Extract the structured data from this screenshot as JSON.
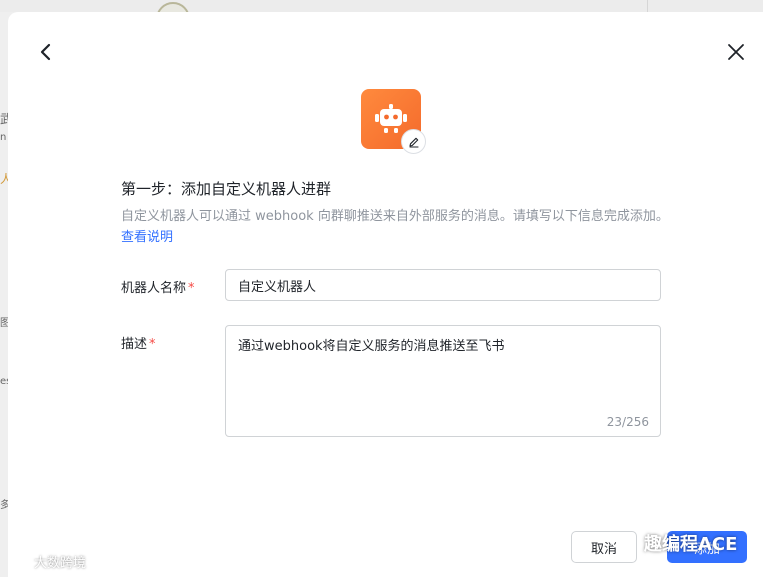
{
  "background": {
    "fragments": [
      "武",
      "n",
      "人",
      "图",
      "es",
      "多"
    ]
  },
  "dialog": {
    "step_title": "第一步：添加自定义机器人进群",
    "description": "自定义机器人可以通过 webhook 向群聊推送来自外部服务的消息。请填写以下信息完成添加。",
    "help_link": "查看说明",
    "name_field": {
      "label": "机器人名称",
      "required_mark": "*",
      "value": "自定义机器人"
    },
    "desc_field": {
      "label": "描述",
      "required_mark": "*",
      "value": "通过webhook将自定义服务的消息推送至飞书",
      "counter": "23/256"
    },
    "buttons": {
      "cancel": "取消",
      "add": "添加"
    }
  },
  "watermarks": {
    "right": "趣编程ACE",
    "left": "大数跨境"
  },
  "colors": {
    "accent": "#3370ff",
    "avatar_orange": "#f46a2c",
    "required": "#f54a45"
  }
}
